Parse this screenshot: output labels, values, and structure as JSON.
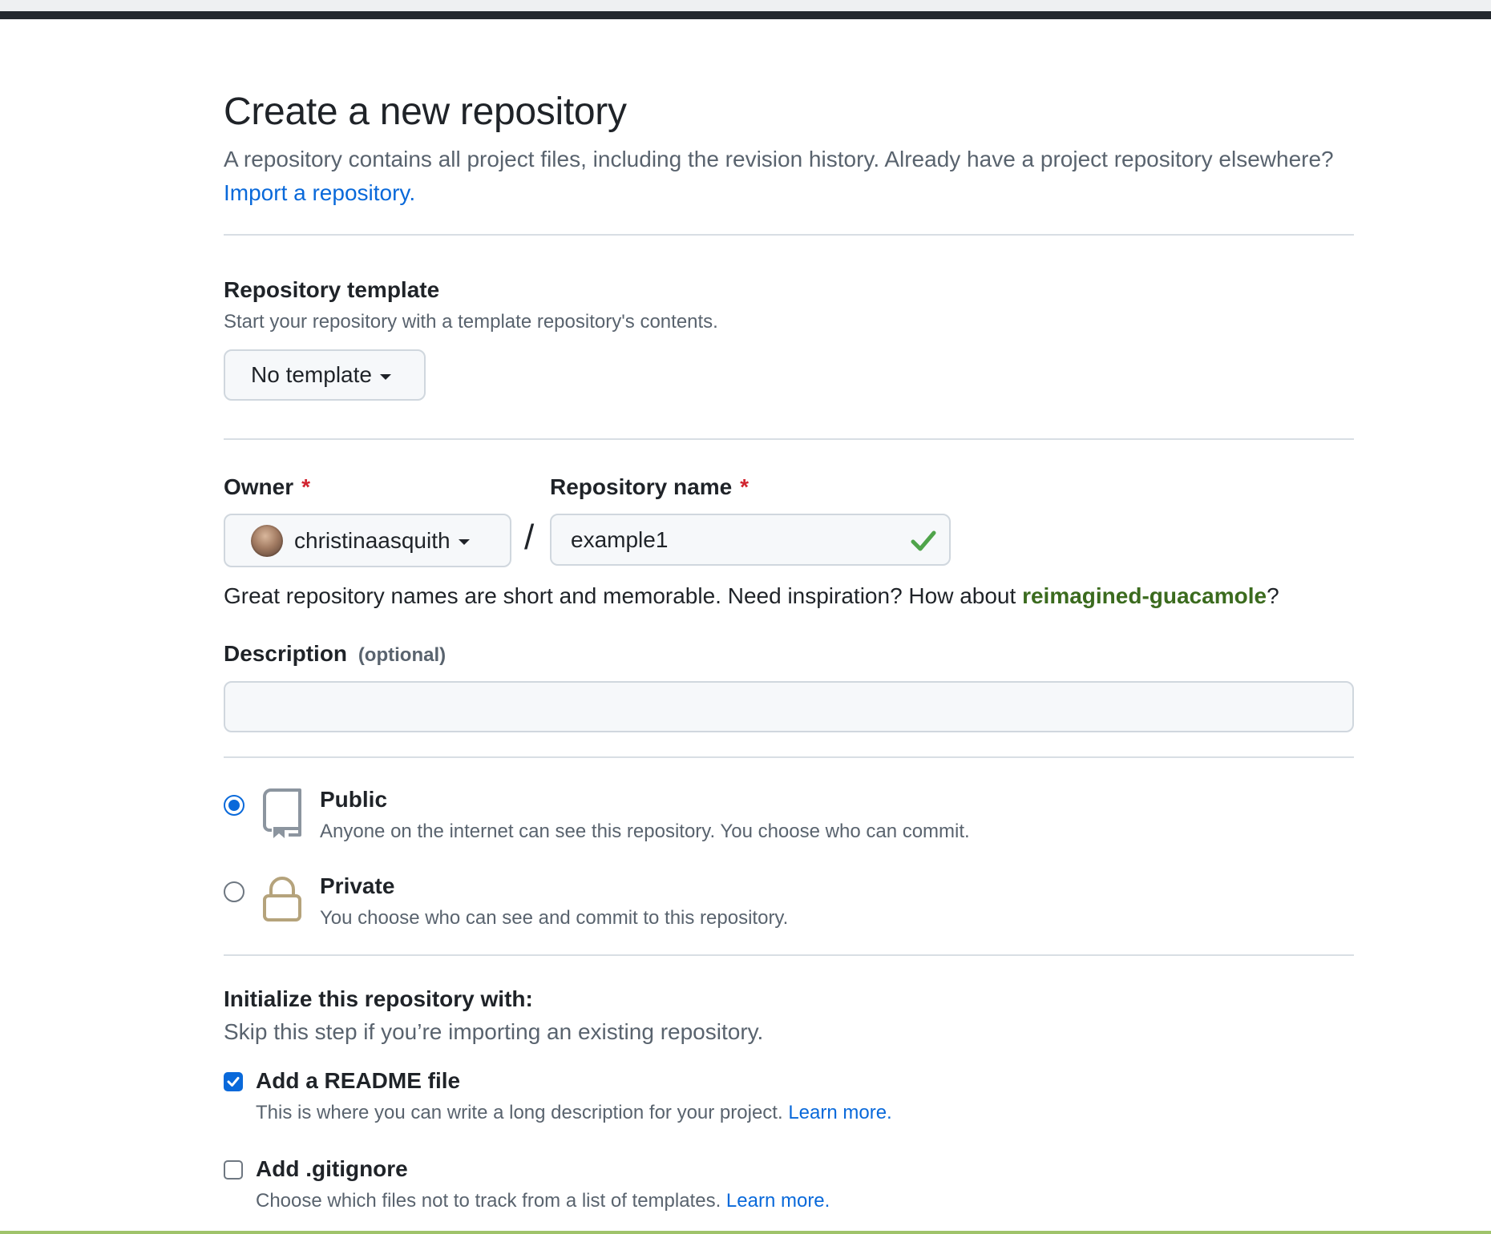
{
  "header": {
    "title": "Create a new repository",
    "intro_text": "A repository contains all project files, including the revision history. Already have a project repository elsewhere?",
    "import_link": "Import a repository."
  },
  "template": {
    "title": "Repository template",
    "note": "Start your repository with a template repository's contents.",
    "selected": "No template"
  },
  "owner": {
    "label": "Owner",
    "required_mark": "*",
    "value": "christinaasquith"
  },
  "separator": "/",
  "repo_name": {
    "label": "Repository name",
    "required_mark": "*",
    "value": "example1",
    "valid": true
  },
  "suggestion": {
    "prefix": "Great repository names are short and memorable. Need inspiration? How about",
    "name": "reimagined-guacamole",
    "suffix": "?"
  },
  "description": {
    "label": "Description",
    "optional": "(optional)",
    "value": ""
  },
  "visibility": {
    "selected": "public",
    "public": {
      "title": "Public",
      "desc": "Anyone on the internet can see this repository. You choose who can commit.",
      "icon": "repo-icon"
    },
    "private": {
      "title": "Private",
      "desc": "You choose who can see and commit to this repository.",
      "icon": "lock-icon"
    }
  },
  "initialize": {
    "title": "Initialize this repository with:",
    "note": "Skip this step if you’re importing an existing repository.",
    "readme": {
      "label": "Add a README file",
      "checked": true,
      "desc": "This is where you can write a long description for your project.",
      "link": "Learn more."
    },
    "gitignore": {
      "label": "Add .gitignore",
      "checked": false,
      "desc": "Choose which files not to track from a list of templates.",
      "link": "Learn more."
    }
  },
  "colors": {
    "link": "#0969da",
    "required": "#d1242f",
    "suggestion": "#3b6b1e",
    "valid_check": "#4fa44a",
    "lock_icon": "#b5a37c"
  }
}
